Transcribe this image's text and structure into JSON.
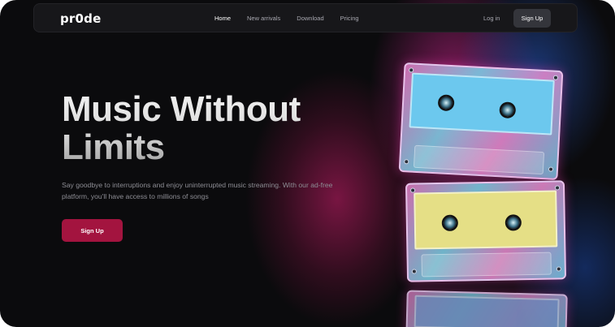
{
  "brand": {
    "logo_text": "pr0de"
  },
  "nav": {
    "links": [
      {
        "label": "Home",
        "active": true
      },
      {
        "label": "New arrivals",
        "active": false
      },
      {
        "label": "Download",
        "active": false
      },
      {
        "label": "Pricing",
        "active": false
      }
    ],
    "login_label": "Log in",
    "signup_label": "Sign Up"
  },
  "hero": {
    "title_line1": "Music Without",
    "title_line2": "Limits",
    "subtitle": "Say goodbye to interruptions and enjoy uninterrupted music streaming. With our ad-free platform, you'll have access to millions of songs",
    "cta_label": "Sign Up"
  },
  "colors": {
    "background": "#0b0b0d",
    "navbar": "#17171a",
    "nav_button": "#34353b",
    "accent": "#a3143f",
    "cassette_top_label": "#6cc8ee",
    "cassette_bottom_label": "#e5df86"
  }
}
